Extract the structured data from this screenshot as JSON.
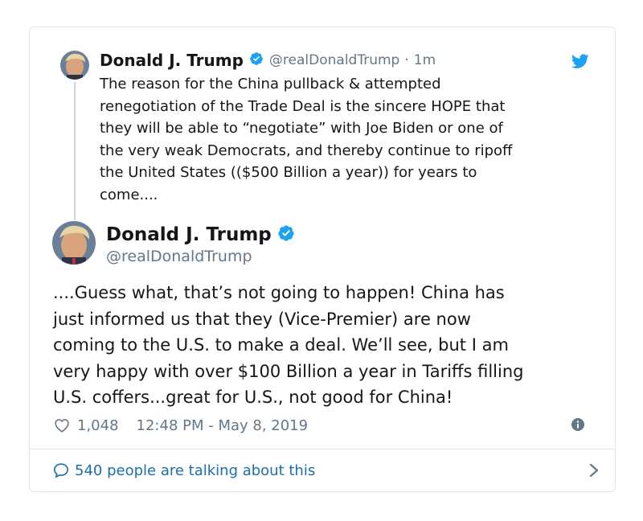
{
  "parent_tweet": {
    "name": "Donald J. Trump",
    "handle": "@realDonaldTrump",
    "separator": "·",
    "time": "1m",
    "text": "The reason for the China pullback & attempted\nrenegotiation of the Trade Deal is the sincere HOPE that\nthey will be able to “negotiate” with Joe Biden or one of\nthe very weak Democrats, and thereby continue to ripoff\nthe United States (($500 Billion a year)) for years to\ncome....",
    "verified_icon": "verified-badge-icon",
    "brand_icon": "twitter-bird-icon"
  },
  "main_tweet": {
    "name": "Donald J. Trump",
    "handle": "@realDonaldTrump",
    "text": "....Guess what, that’s not going to happen! China has\njust informed us that they (Vice-Premier) are now\ncoming to the U.S. to make a deal. We’ll see, but I am\nvery happy with over $100 Billion a year in Tariffs filling\nU.S. coffers...great for U.S., not good for China!",
    "likes": "1,048",
    "timestamp": "12:48 PM - May 8, 2019"
  },
  "footer": {
    "talking_label": "540 people are talking about this"
  },
  "colors": {
    "text": "#14171a",
    "muted": "#657786",
    "link": "#1b6fae",
    "verified": "#1da1f2",
    "border": "#e1e8ed"
  }
}
